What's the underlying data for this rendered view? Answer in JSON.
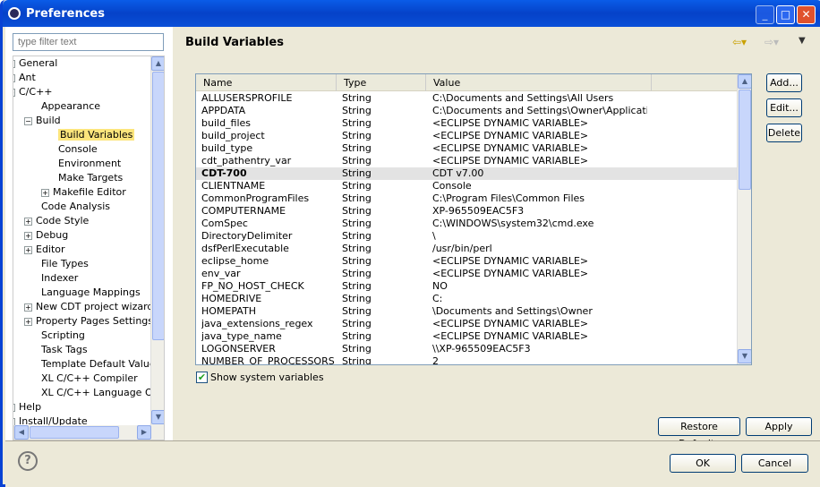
{
  "window": {
    "title": "Preferences",
    "buttons": [
      "minimize",
      "maximize",
      "close"
    ]
  },
  "sidebar": {
    "filter_placeholder": "type filter text",
    "items": [
      {
        "label": "General",
        "level": 0,
        "toggle": "+"
      },
      {
        "label": "Ant",
        "level": 0,
        "toggle": "+"
      },
      {
        "label": "C/C++",
        "level": 0,
        "toggle": "-"
      },
      {
        "label": "Appearance",
        "level": 1,
        "toggle": ""
      },
      {
        "label": "Build",
        "level": 1,
        "toggle": "-"
      },
      {
        "label": "Build Variables",
        "level": 2,
        "toggle": "",
        "selected": true
      },
      {
        "label": "Console",
        "level": 2,
        "toggle": ""
      },
      {
        "label": "Environment",
        "level": 2,
        "toggle": ""
      },
      {
        "label": "Make Targets",
        "level": 2,
        "toggle": ""
      },
      {
        "label": "Makefile Editor",
        "level": 2,
        "toggle": "+"
      },
      {
        "label": "Code Analysis",
        "level": 1,
        "toggle": ""
      },
      {
        "label": "Code Style",
        "level": 1,
        "toggle": "+"
      },
      {
        "label": "Debug",
        "level": 1,
        "toggle": "+"
      },
      {
        "label": "Editor",
        "level": 1,
        "toggle": "+"
      },
      {
        "label": "File Types",
        "level": 1,
        "toggle": ""
      },
      {
        "label": "Indexer",
        "level": 1,
        "toggle": ""
      },
      {
        "label": "Language Mappings",
        "level": 1,
        "toggle": ""
      },
      {
        "label": "New CDT project wizard",
        "level": 1,
        "toggle": "+"
      },
      {
        "label": "Property Pages Settings",
        "level": 1,
        "toggle": "+"
      },
      {
        "label": "Scripting",
        "level": 1,
        "toggle": ""
      },
      {
        "label": "Task Tags",
        "level": 1,
        "toggle": ""
      },
      {
        "label": "Template Default Values",
        "level": 1,
        "toggle": ""
      },
      {
        "label": "XL C/C++ Compiler",
        "level": 1,
        "toggle": ""
      },
      {
        "label": "XL C/C++ Language Options",
        "level": 1,
        "toggle": ""
      },
      {
        "label": "Help",
        "level": 0,
        "toggle": "+"
      },
      {
        "label": "Install/Update",
        "level": 0,
        "toggle": "+"
      }
    ]
  },
  "main": {
    "title": "Build Variables",
    "columns": [
      "Name",
      "Type",
      "Value"
    ],
    "rows": [
      [
        "ALLUSERSPROFILE",
        "String",
        "C:\\Documents and Settings\\All Users"
      ],
      [
        "APPDATA",
        "String",
        "C:\\Documents and Settings\\Owner\\Application ..."
      ],
      [
        "build_files",
        "String",
        "<ECLIPSE DYNAMIC VARIABLE>"
      ],
      [
        "build_project",
        "String",
        "<ECLIPSE DYNAMIC VARIABLE>"
      ],
      [
        "build_type",
        "String",
        "<ECLIPSE DYNAMIC VARIABLE>"
      ],
      [
        "cdt_pathentry_var",
        "String",
        "<ECLIPSE DYNAMIC VARIABLE>"
      ],
      [
        "CDT-700",
        "String",
        "CDT v7.00"
      ],
      [
        "CLIENTNAME",
        "String",
        "Console"
      ],
      [
        "CommonProgramFiles",
        "String",
        "C:\\Program Files\\Common Files"
      ],
      [
        "COMPUTERNAME",
        "String",
        "XP-965509EAC5F3"
      ],
      [
        "ComSpec",
        "String",
        "C:\\WINDOWS\\system32\\cmd.exe"
      ],
      [
        "DirectoryDelimiter",
        "String",
        "\\"
      ],
      [
        "dsfPerlExecutable",
        "String",
        "/usr/bin/perl"
      ],
      [
        "eclipse_home",
        "String",
        "<ECLIPSE DYNAMIC VARIABLE>"
      ],
      [
        "env_var",
        "String",
        "<ECLIPSE DYNAMIC VARIABLE>"
      ],
      [
        "FP_NO_HOST_CHECK",
        "String",
        "NO"
      ],
      [
        "HOMEDRIVE",
        "String",
        "C:"
      ],
      [
        "HOMEPATH",
        "String",
        "\\Documents and Settings\\Owner"
      ],
      [
        "java_extensions_regex",
        "String",
        "<ECLIPSE DYNAMIC VARIABLE>"
      ],
      [
        "java_type_name",
        "String",
        "<ECLIPSE DYNAMIC VARIABLE>"
      ],
      [
        "LOGONSERVER",
        "String",
        "\\\\XP-965509EAC5F3"
      ],
      [
        "NUMBER_OF_PROCESSORS",
        "String",
        "2"
      ]
    ],
    "selected_row": "CDT-700",
    "add_label": "Add...",
    "edit_label": "Edit...",
    "delete_label": "Delete",
    "show_system_label": "Show system variables",
    "show_system_checked": true,
    "restore_label": "Restore Defaults",
    "apply_label": "Apply"
  },
  "footer": {
    "ok_label": "OK",
    "cancel_label": "Cancel"
  }
}
